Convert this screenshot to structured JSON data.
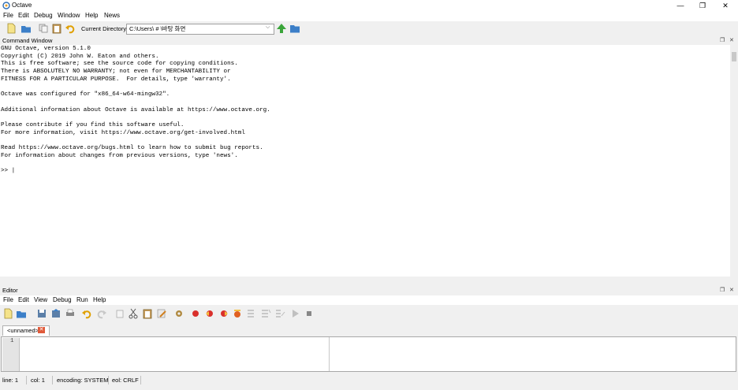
{
  "window": {
    "title": "Octave",
    "controls": {
      "minimize": "—",
      "restore": "❐",
      "close": "✕"
    }
  },
  "main_menu": [
    "File",
    "Edit",
    "Debug",
    "Window",
    "Help",
    "News"
  ],
  "toolbar": {
    "current_directory_label": "Current Directory:",
    "current_directory_value": "C:\\Users\\         #          \\바탕 화면"
  },
  "command_window": {
    "title": "Command Window",
    "lines": [
      "GNU Octave, version 5.1.0",
      "Copyright (C) 2019 John W. Eaton and others.",
      "This is free software; see the source code for copying conditions.",
      "There is ABSOLUTELY NO WARRANTY; not even for MERCHANTABILITY or",
      "FITNESS FOR A PARTICULAR PURPOSE.  For details, type 'warranty'.",
      "",
      "Octave was configured for \"x86_64-w64-mingw32\".",
      "",
      "Additional information about Octave is available at https://www.octave.org.",
      "",
      "Please contribute if you find this software useful.",
      "For more information, visit https://www.octave.org/get-involved.html",
      "",
      "Read https://www.octave.org/bugs.html to learn how to submit bug reports.",
      "For information about changes from previous versions, type 'news'.",
      "",
      ">> |"
    ]
  },
  "editor": {
    "title": "Editor",
    "menu": [
      "File",
      "Edit",
      "View",
      "Debug",
      "Run",
      "Help"
    ],
    "tab_label": "<unnamed>",
    "line_number": "1"
  },
  "status": {
    "line": "line: 1",
    "col": "col: 1",
    "encoding": "encoding: SYSTEM",
    "eol": "eol: CRLF"
  },
  "colors": {
    "folder": "#3c7fc8",
    "new_file": "#f5e38a",
    "up_arrow": "#3aa53a",
    "breakpoint": "#d9302c",
    "tab_close": "#e05a3a"
  }
}
